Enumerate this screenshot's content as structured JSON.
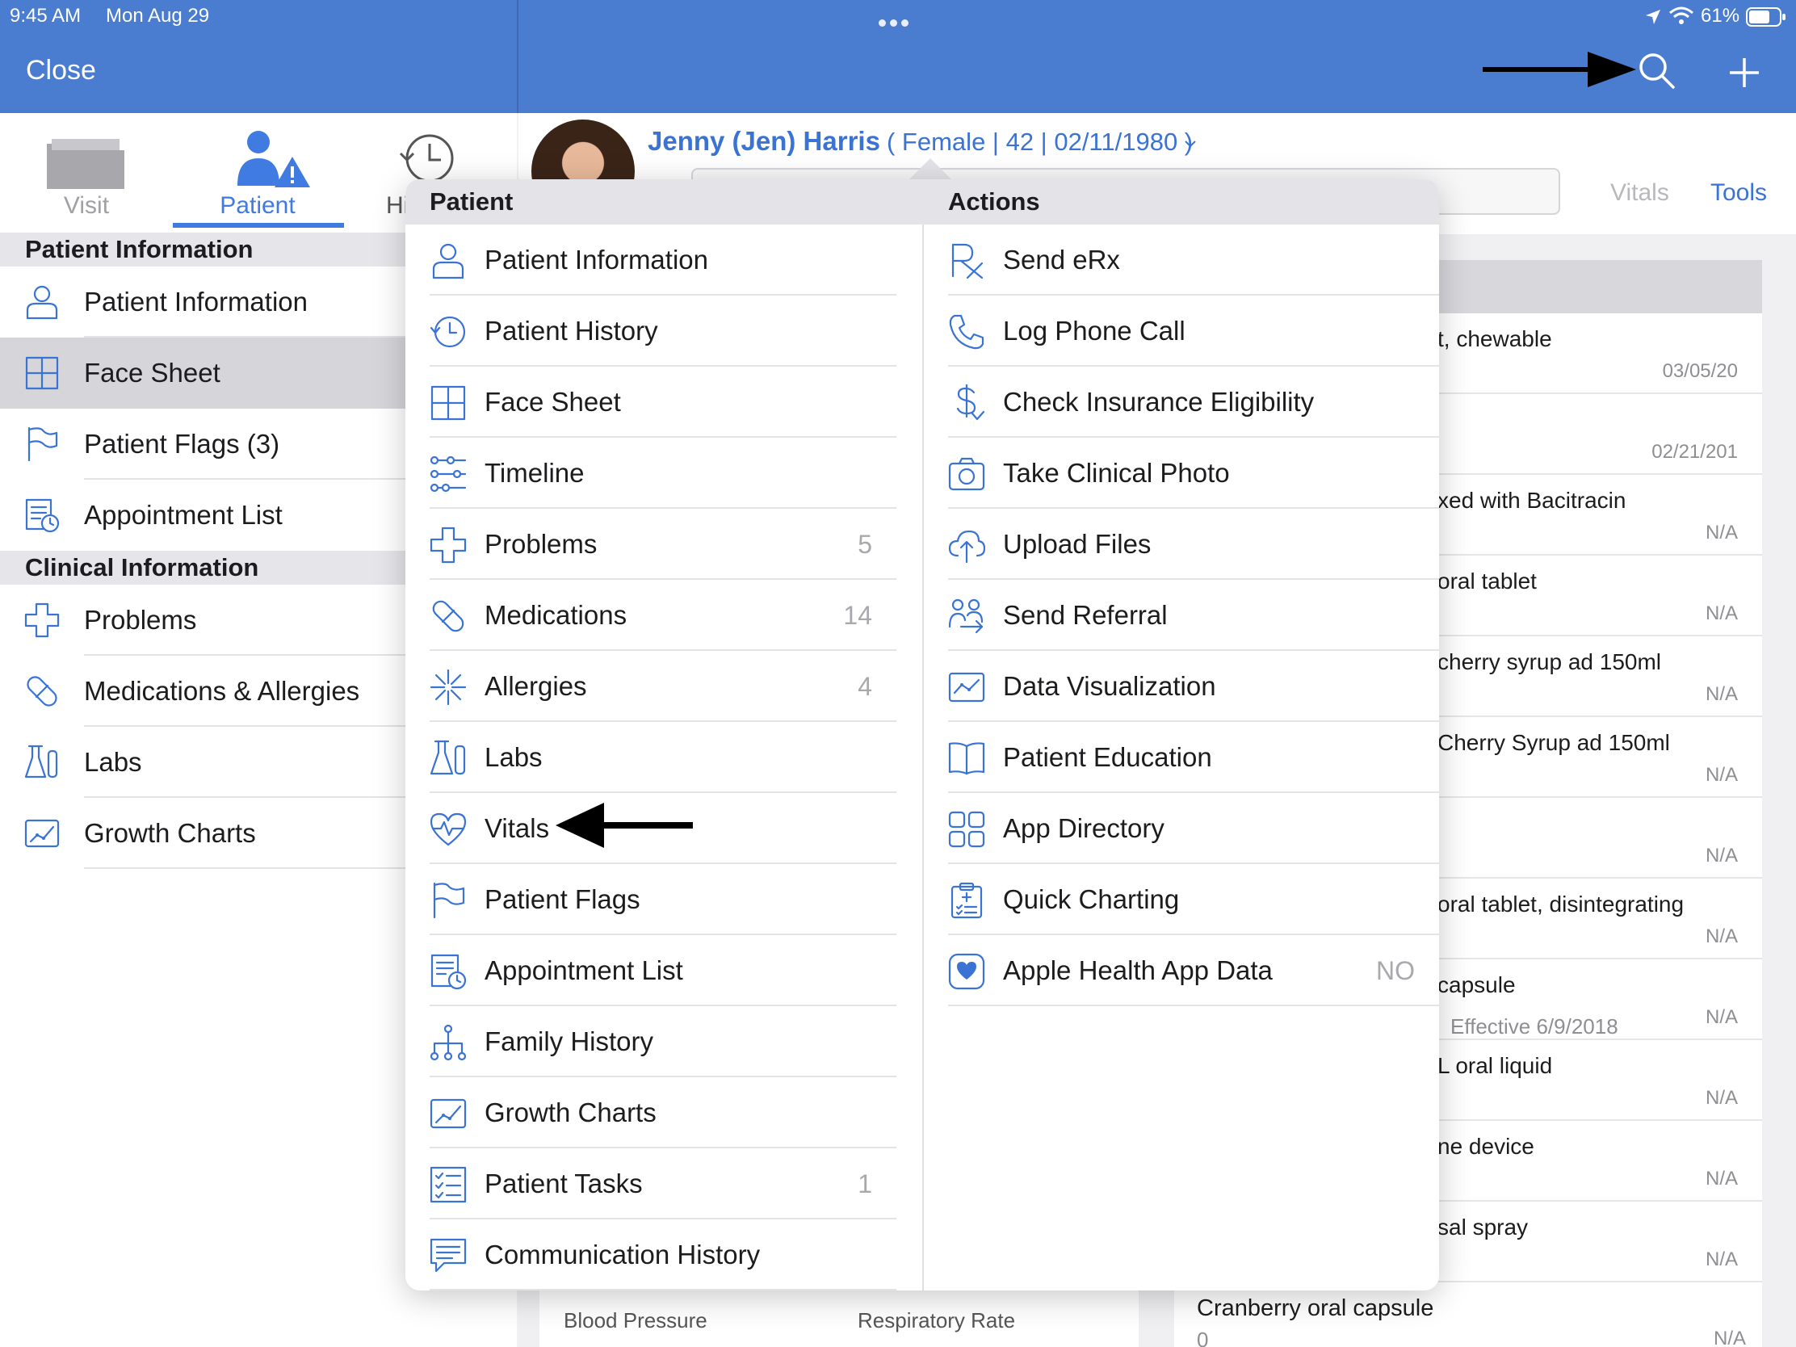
{
  "status_bar": {
    "time": "9:45 AM",
    "date": "Mon Aug 29",
    "battery": "61%"
  },
  "nav": {
    "close_label": "Close"
  },
  "sidebar": {
    "tabs": [
      {
        "label": "Visit"
      },
      {
        "label": "Patient"
      },
      {
        "label": "Hi"
      }
    ],
    "sections": [
      {
        "title": "Patient Information",
        "items": [
          "Patient Information",
          "Face Sheet",
          "Patient Flags (3)",
          "Appointment List"
        ]
      },
      {
        "title": "Clinical Information",
        "items": [
          "Problems",
          "Medications & Allergies",
          "Labs",
          "Growth Charts"
        ]
      }
    ]
  },
  "patient": {
    "name": "Jenny (Jen) Harris",
    "demographics": "( Female | 42 | 02/11/1980 )"
  },
  "main_tabs": {
    "vitals": "Vitals",
    "tools": "Tools"
  },
  "med_list": [
    {
      "name": "t, chewable",
      "sub": "",
      "right": "03/05/20"
    },
    {
      "name": "",
      "sub": "",
      "right": "02/21/201"
    },
    {
      "name": "xed with Bacitracin",
      "sub": "",
      "right": "N/A"
    },
    {
      "name": "oral tablet",
      "sub": "",
      "right": "N/A"
    },
    {
      "name": "cherry syrup ad 150ml",
      "sub": "",
      "right": "N/A"
    },
    {
      "name": "Cherry Syrup ad 150ml",
      "sub": "",
      "right": "N/A"
    },
    {
      "name": "",
      "sub": "",
      "right": "N/A"
    },
    {
      "name": "oral tablet, disintegrating",
      "sub": "",
      "right": "N/A"
    },
    {
      "name": "capsule",
      "sub": "Effective 6/9/2018",
      "right": "N/A"
    },
    {
      "name": "L oral liquid",
      "sub": "",
      "right": "N/A"
    },
    {
      "name": "ne device",
      "sub": "",
      "right": "N/A"
    },
    {
      "name": "sal spray",
      "sub": "",
      "right": "N/A"
    }
  ],
  "bottom": {
    "cranberry": "Cranberry oral capsule",
    "cranberry_sub": "0",
    "cranberry_right": "N/A",
    "blood_pressure": "Blood Pressure",
    "respiratory_rate": "Respiratory Rate"
  },
  "popover": {
    "left_title": "Patient",
    "right_title": "Actions",
    "patient_items": [
      {
        "label": "Patient Information",
        "count": "",
        "icon": "person-icon"
      },
      {
        "label": "Patient History",
        "count": "",
        "icon": "history-icon"
      },
      {
        "label": "Face Sheet",
        "count": "",
        "icon": "grid-icon"
      },
      {
        "label": "Timeline",
        "count": "",
        "icon": "timeline-icon"
      },
      {
        "label": "Problems",
        "count": "5",
        "icon": "cross-icon"
      },
      {
        "label": "Medications",
        "count": "14",
        "icon": "pill-icon"
      },
      {
        "label": "Allergies",
        "count": "4",
        "icon": "allergy-icon"
      },
      {
        "label": "Labs",
        "count": "",
        "icon": "flask-icon"
      },
      {
        "label": "Vitals",
        "count": "",
        "icon": "heartbeat-icon"
      },
      {
        "label": "Patient Flags",
        "count": "",
        "icon": "flag-icon"
      },
      {
        "label": "Appointment List",
        "count": "",
        "icon": "appointment-icon"
      },
      {
        "label": "Family History",
        "count": "",
        "icon": "family-tree-icon"
      },
      {
        "label": "Growth Charts",
        "count": "",
        "icon": "growth-chart-icon"
      },
      {
        "label": "Patient Tasks",
        "count": "1",
        "icon": "checklist-icon"
      },
      {
        "label": "Communication History",
        "count": "",
        "icon": "message-icon"
      }
    ],
    "action_items": [
      {
        "label": "Send eRx",
        "value": "",
        "icon": "rx-icon"
      },
      {
        "label": "Log Phone Call",
        "value": "",
        "icon": "phone-icon"
      },
      {
        "label": "Check Insurance Eligibility",
        "value": "",
        "icon": "dollar-icon"
      },
      {
        "label": "Take Clinical Photo",
        "value": "",
        "icon": "camera-icon"
      },
      {
        "label": "Upload Files",
        "value": "",
        "icon": "cloud-upload-icon"
      },
      {
        "label": "Send Referral",
        "value": "",
        "icon": "referral-icon"
      },
      {
        "label": "Data Visualization",
        "value": "",
        "icon": "chart-icon"
      },
      {
        "label": "Patient Education",
        "value": "",
        "icon": "book-icon"
      },
      {
        "label": "App Directory",
        "value": "",
        "icon": "app-grid-icon"
      },
      {
        "label": "Quick Charting",
        "value": "",
        "icon": "clipboard-icon"
      },
      {
        "label": "Apple Health App Data",
        "value": "NO",
        "icon": "health-heart-icon"
      }
    ]
  },
  "colors": {
    "bar": "#4a7ccf",
    "accent": "#3a73d4"
  }
}
